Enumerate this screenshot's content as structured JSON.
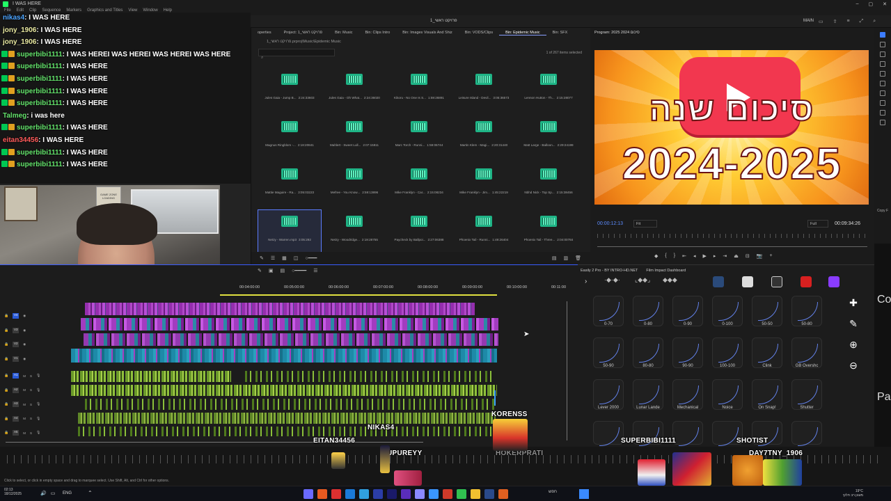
{
  "window": {
    "title": "1_פרויקט ראשי",
    "file_path_fragment": "I WAS HERE",
    "menu": [
      "File",
      "Edit",
      "Clip",
      "Sequence",
      "Markers",
      "Graphics and Titles",
      "View",
      "Window",
      "Help"
    ],
    "workspace": "MAIN"
  },
  "chat": {
    "messages": [
      {
        "user": "nikas4",
        "text": ": I WAS HERE",
        "color": "#4aa3ff",
        "badges": []
      },
      {
        "user": "jony_1906",
        "text": ": I WAS HERE",
        "color": "#e8e8a0",
        "badges": []
      },
      {
        "user": "jony_1906",
        "text": ": I WAS HERE",
        "color": "#e8e8a0",
        "badges": []
      },
      {
        "user": "superbibi1111",
        "text": ": I WAS HEREI WAS HEREI WAS HEREI WAS HERE",
        "color": "#63e36b",
        "badges": [
          "green",
          "gold"
        ]
      },
      {
        "user": "superbibi1111",
        "text": ": I WAS HERE",
        "color": "#63e36b",
        "badges": [
          "green",
          "gold"
        ]
      },
      {
        "user": "superbibi1111",
        "text": ": I WAS HERE",
        "color": "#63e36b",
        "badges": [
          "green",
          "gold"
        ]
      },
      {
        "user": "superbibi1111",
        "text": ": I WAS HERE",
        "color": "#63e36b",
        "badges": [
          "green",
          "gold"
        ]
      },
      {
        "user": "superbibi1111",
        "text": ": I WAS HERE",
        "color": "#63e36b",
        "badges": [
          "green",
          "gold"
        ]
      },
      {
        "user": "Talmeg",
        "text": ": i was here",
        "color": "#63e36b",
        "badges": []
      },
      {
        "user": "superbibi1111",
        "text": ": I WAS HERE",
        "color": "#63e36b",
        "badges": [
          "green",
          "gold"
        ]
      },
      {
        "user": "eitan34456",
        "text": ": I WAS HERE",
        "color": "#ff5a5a",
        "badges": []
      },
      {
        "user": "superbibi1111",
        "text": ": I WAS HERE",
        "color": "#63e36b",
        "badges": [
          "green",
          "gold"
        ]
      },
      {
        "user": "superbibi1111",
        "text": ": I WAS HERE",
        "color": "#63e36b",
        "badges": [
          "green",
          "gold"
        ]
      }
    ]
  },
  "webcam": {
    "poster_text": "GAME ZONE\nLOADING"
  },
  "project": {
    "tabs": [
      "operties",
      "Project: 1_פרויקט ראשי",
      "Bin: Music",
      "Bin: Clips Intro",
      "Bin: Images Visuals And Shiz",
      "Bin: VODS/Clips",
      "Bin: Epidemic Music",
      "Bin: SFX"
    ],
    "active_tab": "Bin: Epidemic Music",
    "path": "1_פרויקט ראשי.prproj\\Music\\Epidemic Music",
    "count": "1 of 267 items selected",
    "clips": [
      {
        "name": "Jules Gaia - Jump B...",
        "dur": "2:24:33603"
      },
      {
        "name": "Jules Gaia - Oh What...",
        "dur": "2:24:36020"
      },
      {
        "name": "Kikoru - No One Is S...",
        "dur": "1:59:26891"
      },
      {
        "name": "Leisure Island - Devil...",
        "dur": "3:05:36573"
      },
      {
        "name": "Lennon Hutton - Th...",
        "dur": "2:15:28077"
      },
      {
        "name": "Magnus Ringblom -...",
        "dur": "2:18:20841"
      },
      {
        "name": "Mahlert - Sweet Lull...",
        "dur": "2:07:15811"
      },
      {
        "name": "Marc Torch - Runni...",
        "dur": "1:59:06744"
      },
      {
        "name": "Martin Klem - Magi...",
        "dur": "2:20:31440"
      },
      {
        "name": "Matt Large - Balloon...",
        "dur": "2:29:24199"
      },
      {
        "name": "Mattie Maguire - Ra...",
        "dur": "3:05:03223"
      },
      {
        "name": "Mefree - You Know...",
        "dur": "2:59:13896"
      },
      {
        "name": "Mike Franklyn - Car...",
        "dur": "2:15:08234"
      },
      {
        "name": "Mike Franklyn - Jim...",
        "dur": "1:45:22219"
      },
      {
        "name": "Nbhd Nick - Top Sp...",
        "dur": "2:15:38456"
      },
      {
        "name": "Netzy - Warren.mp3",
        "dur": "3:05:292"
      },
      {
        "name": "Netzy - Woodridge...",
        "dur": "2:19:28755"
      },
      {
        "name": "Paycheck by Ballpoi...",
        "dur": "2:27:06388"
      },
      {
        "name": "Phoenix Tail - Runni...",
        "dur": "1:49:26404"
      },
      {
        "name": "Phoenix Tail - Three...",
        "dur": "2:04:00784"
      }
    ]
  },
  "program": {
    "title": "Program: 2025 סיכום 2024",
    "headline": "סיכום שנה",
    "year": "2024-2025",
    "timecode": "00:00:12:13",
    "fit": "Fit",
    "quality": "Full",
    "duration": "00:09:34:26"
  },
  "timeline": {
    "ruler": [
      "00:04:00:00",
      "00:05:00:00",
      "00:06:00:00",
      "00:07:00:00",
      "00:08:00:00",
      "00:09:00:00",
      "00:10:00:00",
      "00:11:00"
    ],
    "video_tracks": [
      "V4",
      "V3",
      "V2",
      "V1"
    ],
    "audio_tracks": [
      "A1",
      "A2",
      "A3",
      "A4",
      "A5"
    ],
    "track_toggles": [
      "M",
      "S"
    ]
  },
  "easing": {
    "tabs": [
      "Easily 2 Pro - BY INTRO-HD.NET",
      "Film Impact Dashboard"
    ],
    "presets": [
      "0-70",
      "0-80",
      "0-90",
      "0-100",
      "50-50",
      "50-80",
      "50-90",
      "80-80",
      "90-90",
      "100-100",
      "Clink",
      "GB Overshc",
      "Lever 2000",
      "Lunar Lande",
      "Mechanical",
      "Noice",
      "On Snap!",
      "Shutter"
    ]
  },
  "edge_text": {
    "top": "Co",
    "bottom": "Pa",
    "copy": "Copy F"
  },
  "overlay_names": [
    "KORENSS",
    "NIKAS4",
    "EITAN34456",
    "UPUREYY",
    "HOKERPRATI",
    "SUPERBIBI1111",
    "SHOTIST",
    "DAY7TNY_1906"
  ],
  "status": {
    "hint": "Click to select, or click in empty space and drag to marquee select. Use Shift, Alt, and Ctrl for other options."
  },
  "taskbar": {
    "time": "02:13",
    "date": "18/12/2025",
    "lang": "ENG",
    "search": "חפש",
    "right_text": "19°C\nמעונן רב חלקי"
  }
}
